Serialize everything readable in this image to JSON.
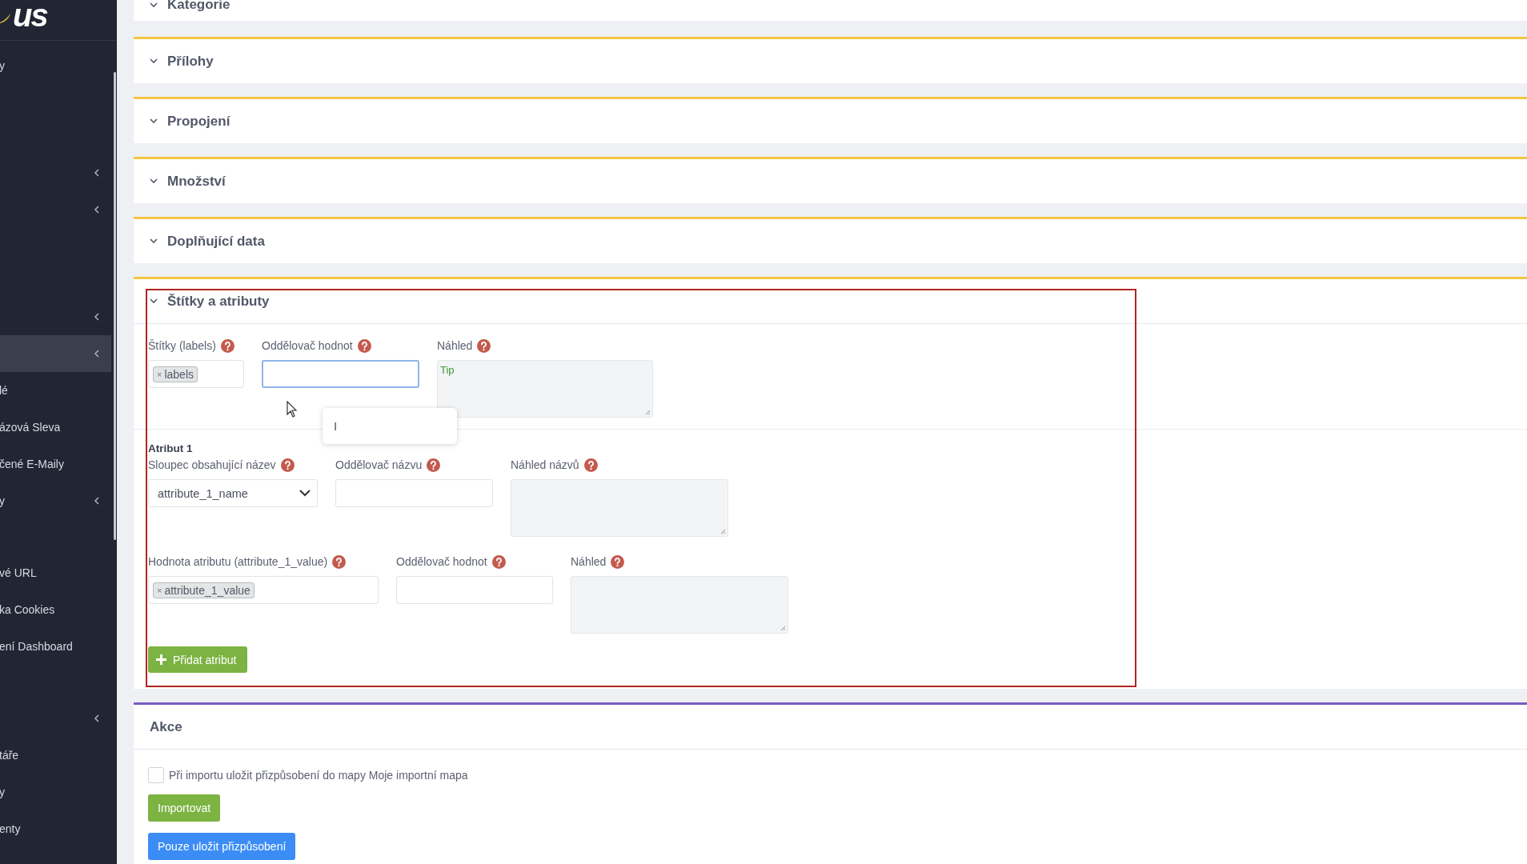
{
  "sidebar": {
    "logo": "us",
    "groups": [
      [
        {
          "label": "y",
          "submenu": false,
          "selected": false
        }
      ],
      [
        {
          "submenu": true,
          "selected": false
        },
        {
          "submenu": true,
          "selected": false
        }
      ],
      [
        {
          "submenu": true,
          "selected": false
        },
        {
          "submenu": true,
          "selected": true
        },
        {
          "label": "lé",
          "submenu": false,
          "selected": false
        },
        {
          "label": "ázová Sleva",
          "submenu": false,
          "selected": false
        },
        {
          "label": "čené E-Maily",
          "submenu": false,
          "selected": false
        },
        {
          "label": "y",
          "submenu": true,
          "selected": false
        }
      ],
      [
        {
          "label": "vé URL",
          "submenu": false,
          "selected": false
        },
        {
          "label": "ka Cookies",
          "submenu": false,
          "selected": false
        },
        {
          "label": "ení Dashboard",
          "submenu": false,
          "selected": false
        }
      ],
      [
        {
          "submenu": true,
          "selected": false
        },
        {
          "label": "táře",
          "submenu": false,
          "selected": false
        },
        {
          "label": "y",
          "submenu": false,
          "selected": false
        },
        {
          "label": "enty",
          "submenu": false,
          "selected": false
        }
      ]
    ]
  },
  "panels": [
    {
      "title": "Kategorie"
    },
    {
      "title": "Přílohy"
    },
    {
      "title": "Propojení"
    },
    {
      "title": "Množství"
    },
    {
      "title": "Doplňující data"
    }
  ],
  "attributes_panel": {
    "title": "Štítky a atributy",
    "highlighted": true,
    "rows": [
      {
        "fields": [
          {
            "kind": "tags",
            "label": "Štítky (labels)",
            "tags": [
              {
                "remove": "×",
                "text": "labels"
              }
            ]
          },
          {
            "kind": "input",
            "label": "Oddělovač hodnot",
            "focused": true,
            "popup": "I"
          },
          {
            "kind": "textarea",
            "label": "Náhled",
            "value": "Tip"
          }
        ]
      },
      {
        "heading": "Atribut 1",
        "fields": [
          {
            "kind": "select",
            "label": "Sloupec obsahující název",
            "value": "attribute_1_name"
          },
          {
            "kind": "input",
            "label": "Oddělovač názvu",
            "focused": false
          },
          {
            "kind": "textarea",
            "label": "Náhled názvů"
          }
        ]
      },
      {
        "fields": [
          {
            "kind": "tags",
            "label": "Hodnota atributu (attribute_1_value)",
            "tags": [
              {
                "remove": "×",
                "text": "attribute_1_value"
              }
            ]
          },
          {
            "kind": "input",
            "label": "Oddělovač hodnot",
            "focused": false
          },
          {
            "kind": "textarea",
            "label": "Náhled"
          }
        ]
      }
    ],
    "add_button": "Přidat atribut"
  },
  "actions_panel": {
    "title": "Akce",
    "checkbox": {
      "label": "Při importu uložit přizpůsobení do mapy Moje importní mapa",
      "checked": false
    },
    "buttons": [
      {
        "label": "Importovat",
        "kind": "success"
      },
      {
        "label": "Pouze uložit přizpůsobení",
        "kind": "primary"
      }
    ]
  }
}
